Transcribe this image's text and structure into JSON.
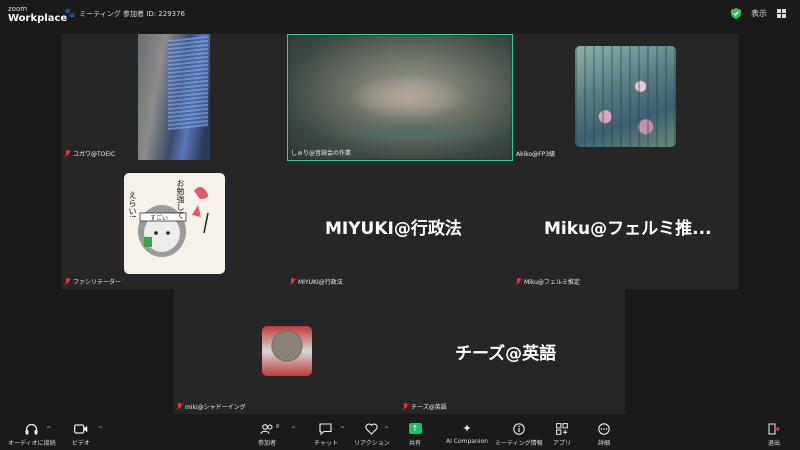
{
  "header": {
    "logo_line1": "zoom",
    "logo_line2": "Workplace",
    "meeting_label": "ミーティング 参加者 ID: 229376",
    "view_label": "表示"
  },
  "tiles": [
    {
      "name": "ユガワ@TOEIC",
      "muted": true
    },
    {
      "name": "しゅり@音読会の作業",
      "muted": false,
      "active": true
    },
    {
      "name": "Akiko@FP3級",
      "muted": false
    },
    {
      "name": "ファシリテーター",
      "muted": true
    },
    {
      "name": "MIYUKI@行政法",
      "display_name": "MIYUKI@行政法",
      "muted": true
    },
    {
      "name": "Miku@フェルミ推定",
      "display_name": "Miku@フェルミ推...",
      "muted": true
    },
    {
      "name": "miki@シャドーイング",
      "muted": true
    },
    {
      "name": "チーズ@英語",
      "display_name": "チーズ@英語",
      "muted": true
    }
  ],
  "sketch_text": {
    "line1": "お勉強して",
    "line2": "えらい!",
    "badge": "すごい"
  },
  "toolbar": {
    "audio": "オーディオに接続",
    "video": "ビデオ",
    "participants": "参加者",
    "participants_count": "8",
    "chat": "チャット",
    "reactions": "リアクション",
    "share": "共有",
    "ai": "AI Companion",
    "info": "ミーティング情報",
    "apps": "アプリ",
    "more": "詳細",
    "leave": "退出"
  },
  "colors": {
    "active_border": "#2fd08b",
    "muted": "#e0383e",
    "share": "#14c46a",
    "secure": "#2fbf5d"
  }
}
